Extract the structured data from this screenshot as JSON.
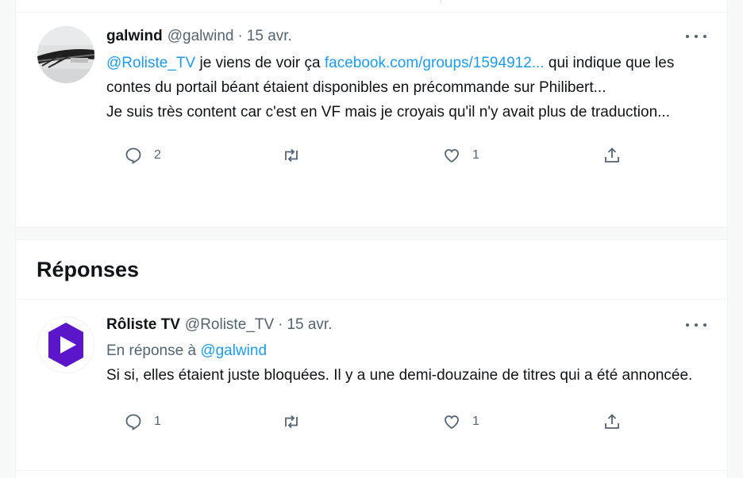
{
  "tweet": {
    "name": "galwind",
    "handle": "@galwind",
    "date": "15 avr.",
    "mention": "@Roliste_TV",
    "text_a": " je viens de voir ça ",
    "link": "facebook.com/groups/1594912...",
    "text_b": " qui indique que les contes du portail béant étaient disponibles en précommande sur Philibert...",
    "text_c": "Je suis très content car c'est en VF mais je croyais qu'il n'y avait plus de traduction...",
    "replies": "2",
    "likes": "1"
  },
  "section": {
    "title": "Réponses"
  },
  "reply": {
    "name": "Rôliste TV",
    "handle": "@Roliste_TV",
    "date": "15 avr.",
    "in_reply_prefix": "En réponse à ",
    "in_reply_to": "@galwind",
    "text": "Si si, elles étaient juste bloquées. Il y a une demi-douzaine de titres qui a été annoncée.",
    "replies": "1",
    "likes": "1"
  },
  "colors": {
    "link": "#1d9bf0",
    "secondary": "#536471",
    "brand_purple": "#5b16c9"
  },
  "icons": [
    "reply-icon",
    "retweet-icon",
    "like-icon",
    "share-icon",
    "more-icon"
  ]
}
